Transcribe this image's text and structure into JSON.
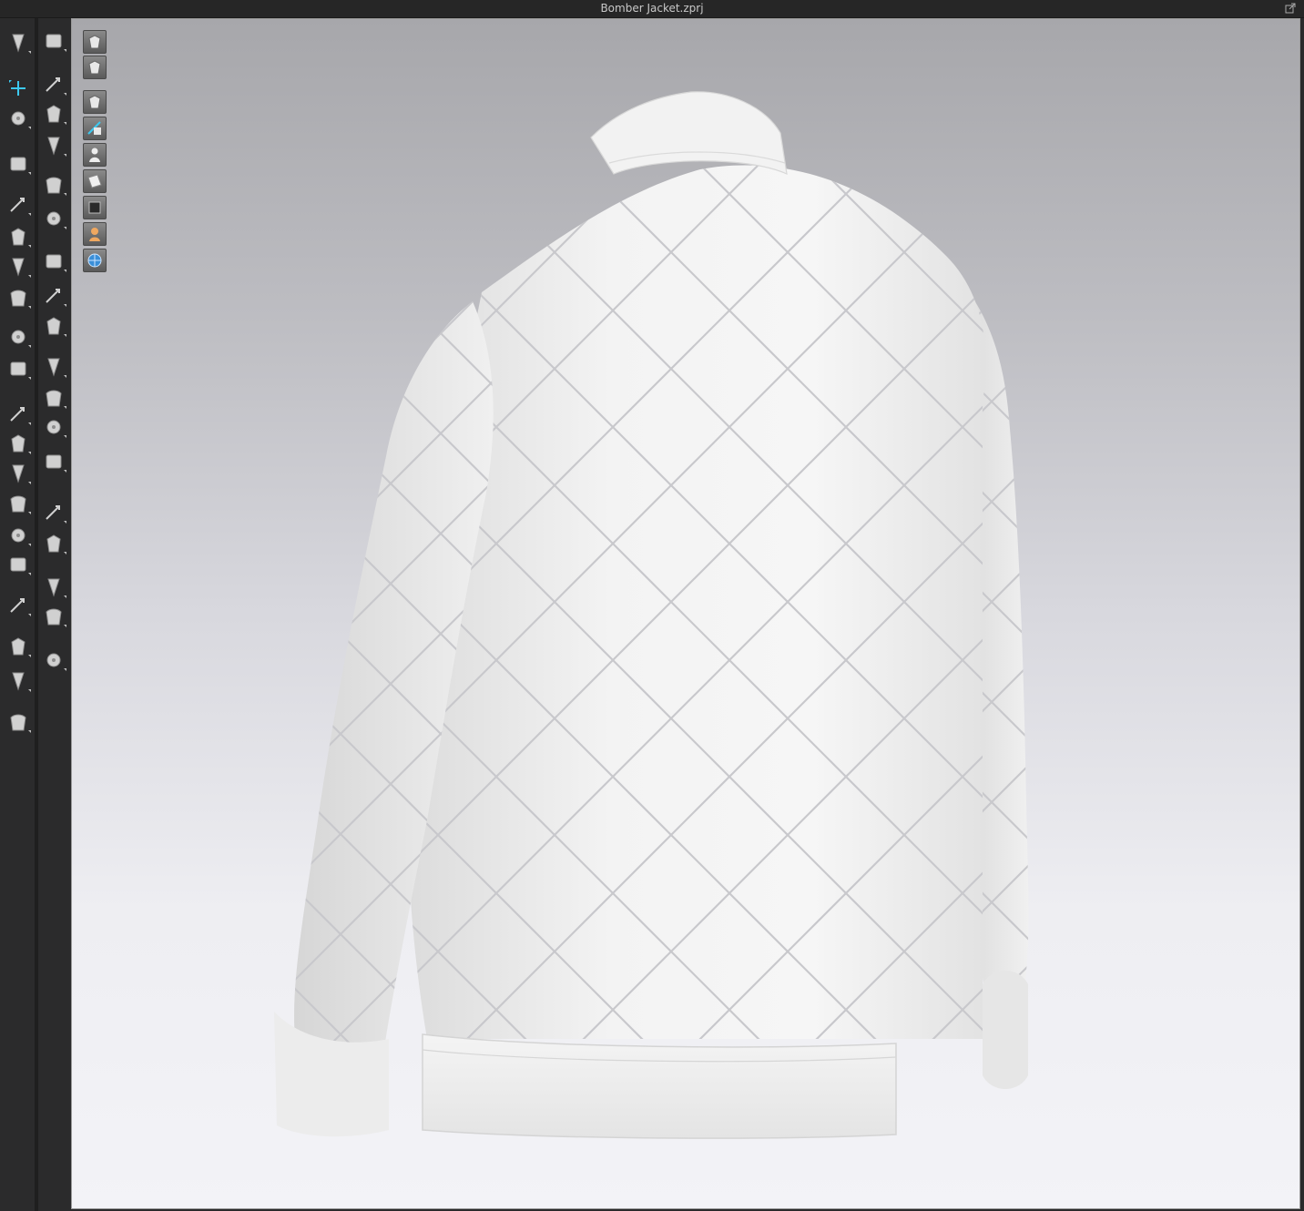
{
  "window": {
    "title": "Bomber Jacket.zprj"
  },
  "toolbar": {
    "left_column": [
      "select-move-icon",
      "transform-pattern-icon",
      "edit-curvature-icon",
      "garment-select-icon",
      "sewing-icon",
      "segment-sewing-icon",
      "tack-icon",
      "pattern-fold-icon",
      "pin-icon",
      "puckering-icon",
      "fold-arrangement-icon",
      "strengthen-icon",
      "garment-fit-icon",
      "avatar-measure-icon",
      "arrangement-icon",
      "layer-icon",
      "seam-taping-icon",
      "measure-icon",
      "drape-garment-icon",
      "drape-fitted-icon"
    ],
    "right_column": [
      "simulate-icon",
      "edit-sewing-icon",
      "thread-icon",
      "elastic-icon",
      "tack-on-avatar-icon",
      "fold-icon",
      "pin-avatar-icon",
      "texture-icon",
      "graphic-icon",
      "button-icon",
      "buttonhole-icon",
      "lock-button-icon",
      "zipper-icon",
      "puckering-fabric-icon",
      "fabric-swatch-icon",
      "layer-fabric-icon",
      "fabric-panel-icon",
      "topstitch-icon"
    ]
  },
  "viewport": {
    "icons": [
      "3d-pattern-view-icon",
      "garment-shape-icon",
      "show-garment-icon",
      "show-internal-icon",
      "show-avatar-icon",
      "show-pattern-icon",
      "show-texture-icon",
      "show-skin-icon",
      "environment-icon"
    ],
    "background_top": "#a7a7ab",
    "background_bottom": "#f3f3f7",
    "garment_color": "#f1f1f1",
    "quilt_line_color": "#c8c8cc"
  }
}
